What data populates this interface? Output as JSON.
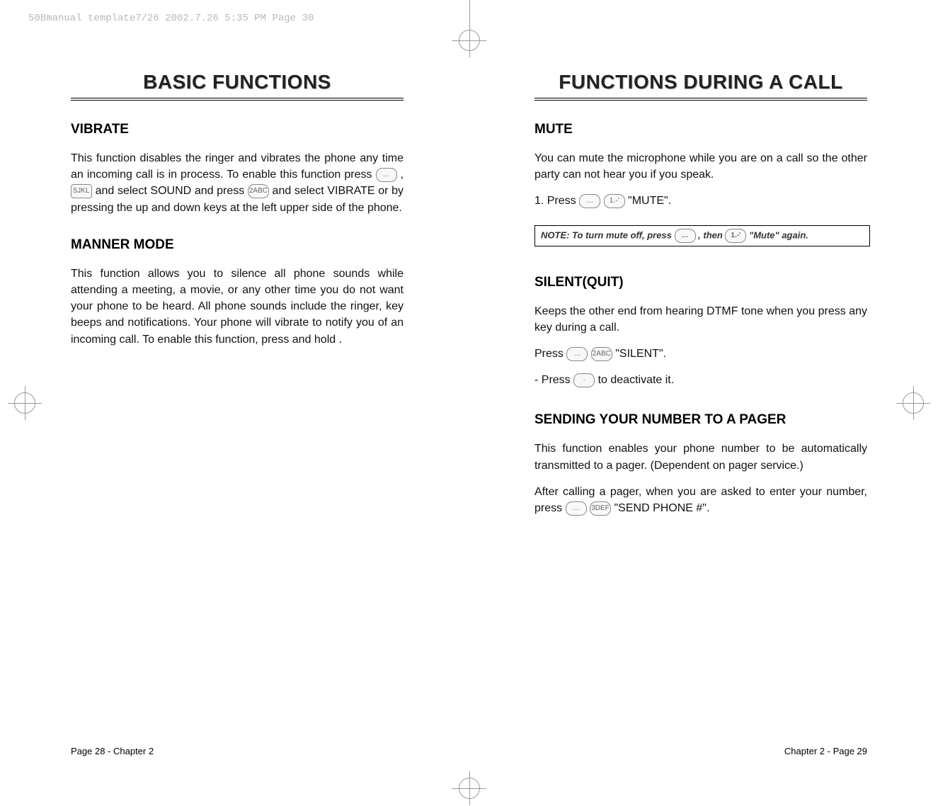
{
  "header_bar": "50Bmanual template7/26  2002.7.26  5:35 PM  Page 30",
  "left_page": {
    "title": "BASIC FUNCTIONS",
    "vibrate": {
      "head": "VIBRATE",
      "body": "This function disables the ringer and vibrates the phone any time an incoming call is in process. To enable this function press     ,     and select SOUND and press     and select VIBRATE or by pressing the up and down keys at the left upper side of the phone."
    },
    "manner": {
      "head": "MANNER MODE",
      "body": "This function allows you to silence all phone sounds while attending a meeting, a movie, or any other time you do not want your phone to be heard. All phone sounds include the ringer, key beeps and notifications. Your phone will vibrate to notify you of an incoming call. To enable this function, press and hold            ."
    },
    "footer": "Page 28 - Chapter 2"
  },
  "right_page": {
    "title": "FUNCTIONS DURING A CALL",
    "mute": {
      "head": "MUTE",
      "body": "You can mute the microphone while you are on a call so the other party can not hear you if you speak.",
      "step1_a": "1. Press ",
      "step1_b": " \"MUTE\".",
      "note_a": "NOTE: To turn mute off, press ",
      "note_b": " , then ",
      "note_c": " \"Mute\" again."
    },
    "silent": {
      "head": "SILENT(QUIT)",
      "body": "Keeps the other end from hearing DTMF tone when you press any key during a call.",
      "press_a": "Press ",
      "press_b": " \"SILENT\".",
      "deact_a": "- Press ",
      "deact_b": " to deactivate it."
    },
    "pager": {
      "head": "SENDING YOUR NUMBER TO A PAGER",
      "body": "This function enables your phone number to be automatically transmitted to a pager. (Dependent on pager service.)",
      "after_a": "After calling a pager, when you are asked to enter your number, press ",
      "after_b": "\"SEND PHONE #\"."
    },
    "footer": "Chapter 2 - Page 29"
  },
  "icons": {
    "menu": "…",
    "five": "5JKL",
    "two": "2ABC",
    "one": "1.-'",
    "three": "3DEF",
    "dot": "·"
  }
}
